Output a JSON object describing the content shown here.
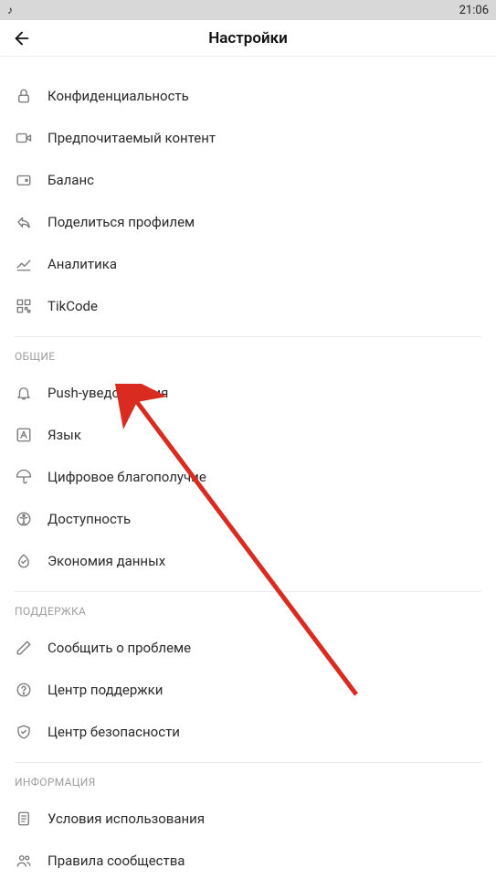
{
  "statusBar": {
    "time": "21:06"
  },
  "header": {
    "title": "Настройки"
  },
  "sections": {
    "account": {
      "items": {
        "privacy": "Конфиденциальность",
        "preferredContent": "Предпочитаемый контент",
        "balance": "Баланс",
        "shareProfile": "Поделиться профилем",
        "analytics": "Аналитика",
        "tikcode": "TikCode"
      }
    },
    "general": {
      "title": "ОБЩИЕ",
      "items": {
        "push": "Push-уведомления",
        "language": "Язык",
        "wellbeing": "Цифровое благополучие",
        "accessibility": "Доступность",
        "dataSaver": "Экономия данных"
      }
    },
    "support": {
      "title": "ПОДДЕРЖКА",
      "items": {
        "report": "Сообщить о проблеме",
        "helpCenter": "Центр поддержки",
        "safetyCenter": "Центр безопасности"
      }
    },
    "info": {
      "title": "ИНФОРМАЦИЯ",
      "items": {
        "terms": "Условия использования",
        "community": "Правила сообщества"
      }
    }
  }
}
